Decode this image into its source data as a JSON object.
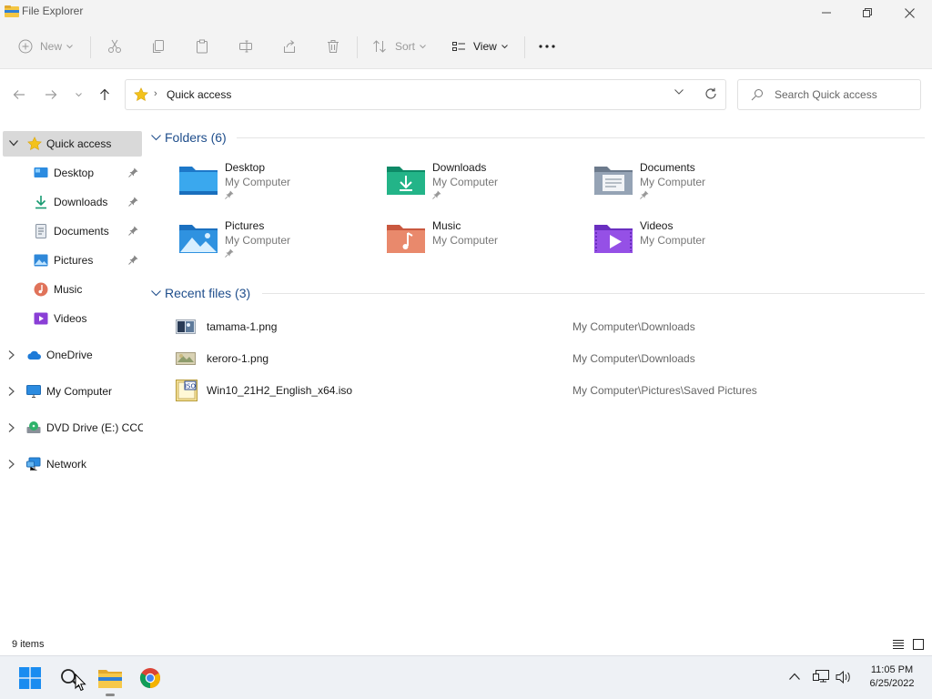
{
  "window": {
    "title": "File Explorer",
    "controls": [
      "minimize-icon",
      "restore-icon",
      "close-icon"
    ]
  },
  "toolbar": {
    "new_label": "New",
    "sort_label": "Sort",
    "view_label": "View",
    "icons": [
      "cut-icon",
      "copy-icon",
      "paste-icon",
      "rename-icon",
      "share-icon",
      "delete-icon",
      "more-icon"
    ]
  },
  "address": {
    "location": "Quick access",
    "search_placeholder": "Search Quick access"
  },
  "sidebar": {
    "items": [
      {
        "label": "Quick access",
        "icon": "star-icon",
        "selected": true
      },
      {
        "label": "Desktop",
        "icon": "desktop-icon",
        "pinned": true
      },
      {
        "label": "Downloads",
        "icon": "download-icon",
        "pinned": true
      },
      {
        "label": "Documents",
        "icon": "document-icon",
        "pinned": true
      },
      {
        "label": "Pictures",
        "icon": "picture-icon",
        "pinned": true
      },
      {
        "label": "Music",
        "icon": "music-icon"
      },
      {
        "label": "Videos",
        "icon": "video-icon"
      },
      {
        "label": "OneDrive",
        "icon": "cloud-icon"
      },
      {
        "label": "My Computer",
        "icon": "computer-icon"
      },
      {
        "label": "DVD Drive (E:) CCCC",
        "icon": "dvd-icon"
      },
      {
        "label": "Network",
        "icon": "network-icon"
      }
    ]
  },
  "main": {
    "folders_header": "Folders (6)",
    "folders": [
      {
        "name": "Desktop",
        "location": "My Computer"
      },
      {
        "name": "Downloads",
        "location": "My Computer"
      },
      {
        "name": "Documents",
        "location": "My Computer"
      },
      {
        "name": "Pictures",
        "location": "My Computer"
      },
      {
        "name": "Music",
        "location": "My Computer"
      },
      {
        "name": "Videos",
        "location": "My Computer"
      }
    ],
    "recent_header": "Recent files (3)",
    "recent": [
      {
        "name": "tamama-1.png",
        "path": "My Computer\\Downloads"
      },
      {
        "name": "keroro-1.png",
        "path": "My Computer\\Downloads"
      },
      {
        "name": "Win10_21H2_English_x64.iso",
        "path": "My Computer\\Pictures\\Saved Pictures"
      }
    ]
  },
  "status": {
    "count": "9 items"
  },
  "taskbar": {
    "time": "11:05 PM",
    "date": "6/25/2022",
    "apps": [
      "start-icon",
      "search-icon",
      "file-explorer-icon",
      "chrome-icon"
    ]
  },
  "colors": {
    "accent": "#0067c0",
    "folder_blue": "#3aa0e0",
    "folder_yellow": "#f4c642",
    "section_text": "#1f4e8c"
  }
}
